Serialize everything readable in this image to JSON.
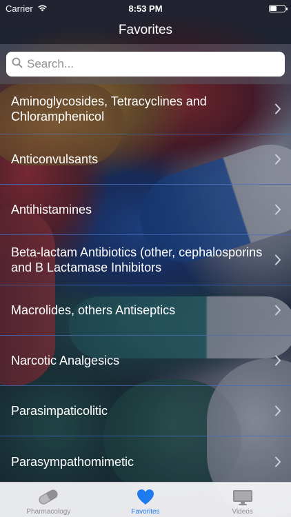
{
  "status_bar": {
    "carrier": "Carrier",
    "time": "8:53 PM"
  },
  "nav": {
    "title": "Favorites"
  },
  "search": {
    "placeholder": "Search..."
  },
  "list": {
    "items": [
      {
        "label": "Aminoglycosides, Tetracyclines and Chloramphenicol"
      },
      {
        "label": "Anticonvulsants"
      },
      {
        "label": "Antihistamines"
      },
      {
        "label": "Beta-lactam Antibiotics (other, cephalosporins and B Lactamase Inhibitors"
      },
      {
        "label": "Macrolides, others Antiseptics"
      },
      {
        "label": "Narcotic Analgesics"
      },
      {
        "label": "Parasimpaticolitic"
      },
      {
        "label": "Parasympathomimetic"
      }
    ]
  },
  "tab_bar": {
    "tabs": [
      {
        "label": "Pharmacology",
        "icon": "pill-icon",
        "active": false
      },
      {
        "label": "Favorites",
        "icon": "heart-icon",
        "active": true
      },
      {
        "label": "Videos",
        "icon": "monitor-icon",
        "active": false
      }
    ]
  },
  "colors": {
    "accent": "#1e7bf0",
    "separator": "#466ebe",
    "inactive_tab": "#8e8e93"
  }
}
